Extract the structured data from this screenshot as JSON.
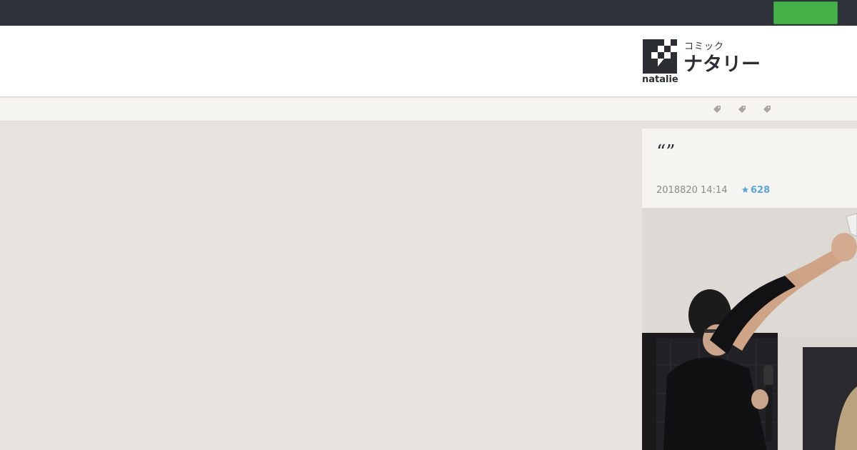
{
  "topbar": {
    "button_label": "",
    "button_color": "#45b149"
  },
  "header": {
    "logo": {
      "subtitle": "コミック",
      "name": "ナタリー",
      "brand": "natalie"
    }
  },
  "tagbar": {
    "tags": [
      {
        "icon": "tag-icon",
        "label": ""
      },
      {
        "icon": "tag-icon",
        "label": ""
      },
      {
        "icon": "tag-icon",
        "label": ""
      }
    ]
  },
  "article": {
    "title": "“”",
    "date": "2018820 14:14",
    "favorite_icon": "star-icon",
    "favorite_count": "628",
    "accent_color": "#5aa7d6",
    "photo_description_icon": "photo"
  }
}
